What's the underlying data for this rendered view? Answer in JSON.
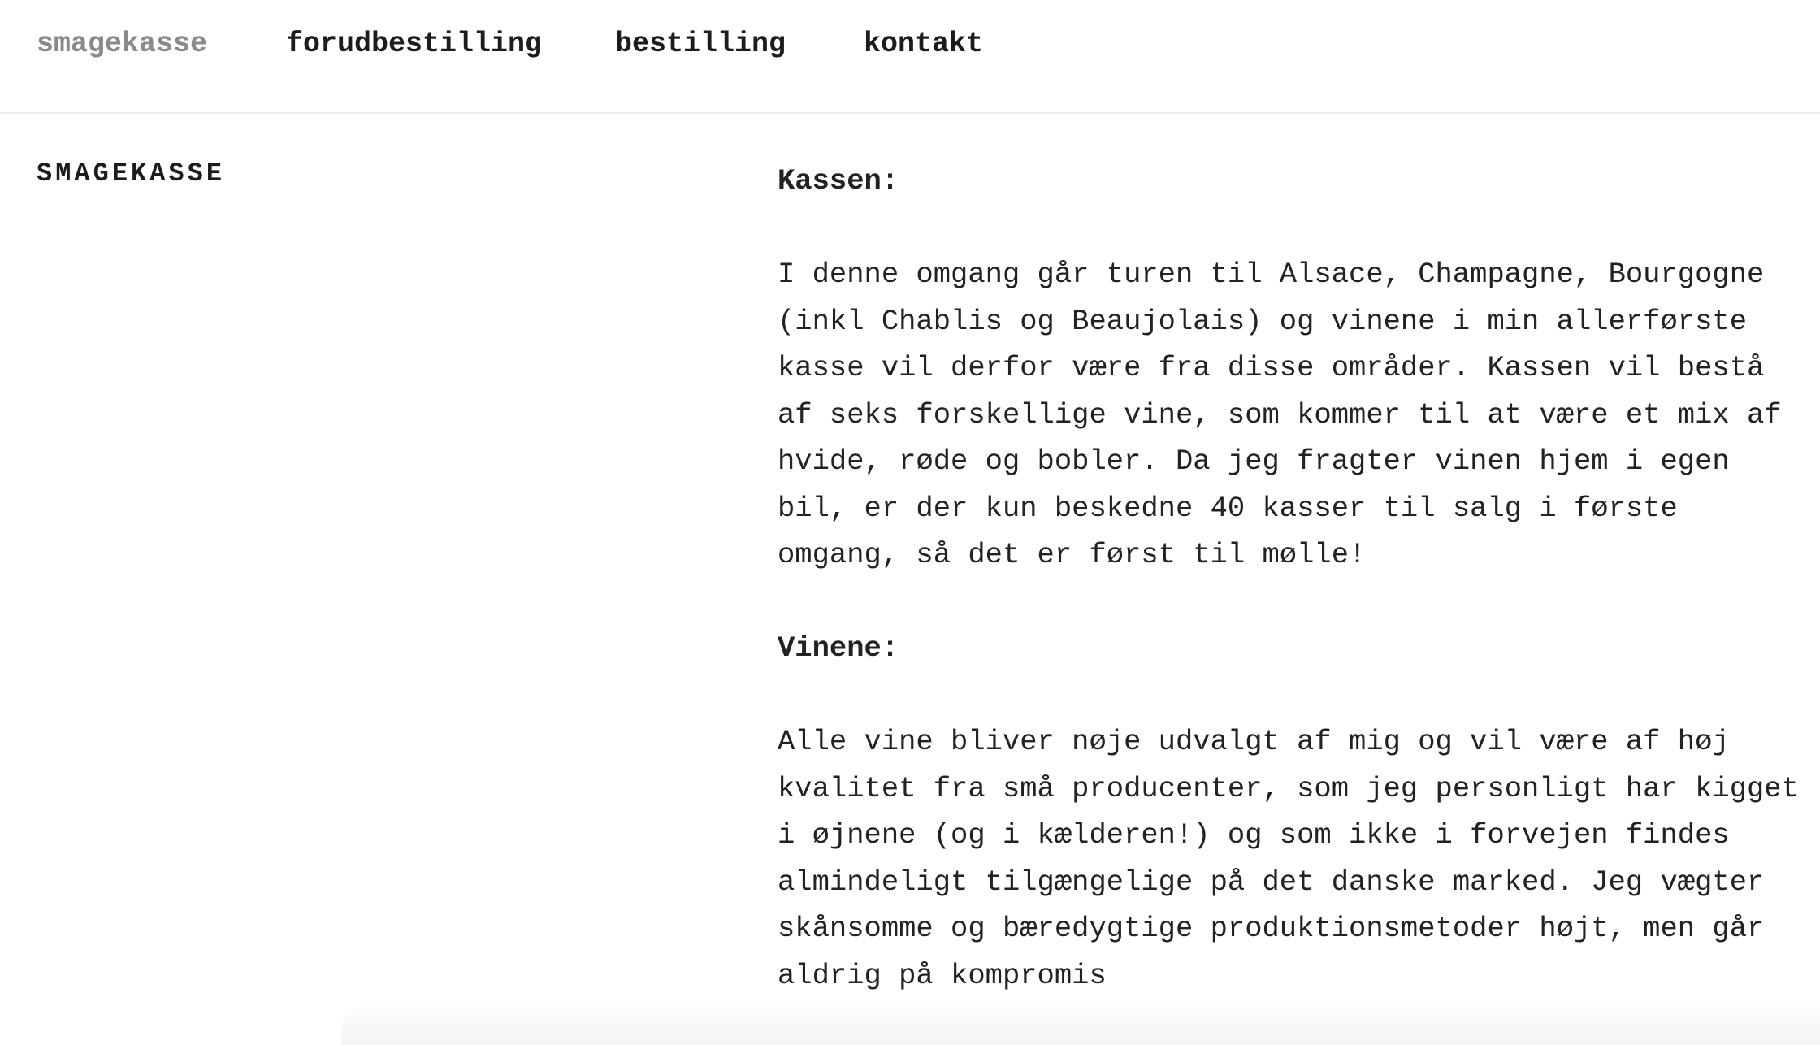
{
  "nav": {
    "items": [
      {
        "label": "smagekasse",
        "active": true
      },
      {
        "label": "forudbestilling",
        "active": false
      },
      {
        "label": "bestilling",
        "active": false
      },
      {
        "label": "kontakt",
        "active": false
      }
    ]
  },
  "sidebar": {
    "title": "SMAGEKASSE"
  },
  "content": {
    "section1_heading": "Kassen:",
    "section1_text": "I denne omgang går turen til Alsace, Champagne, Bourgogne (inkl Chablis og Beaujolais) og vinene i min allerførste kasse vil derfor være fra disse områder. Kassen vil bestå af seks forskellige vine, som kommer til at være et mix af hvide, røde og bobler. Da jeg fragter vinen hjem i egen bil, er der kun beskedne 40 kasser til salg i første omgang, så det er først til mølle!",
    "section2_heading": "Vinene:",
    "section2_text": "Alle vine bliver nøje udvalgt af mig og vil være af høj kvalitet fra små producenter, som jeg personligt har kigget i øjnene (og i kælderen!) og som ikke i forvejen findes almindeligt tilgængelige på det danske marked. Jeg vægter skånsomme og bæredygtige produktionsmetoder højt, men går aldrig på kompromis"
  },
  "colors": {
    "text": "#222222",
    "nav_active": "#8a8a8a",
    "divider": "#ececec",
    "background": "#ffffff"
  }
}
